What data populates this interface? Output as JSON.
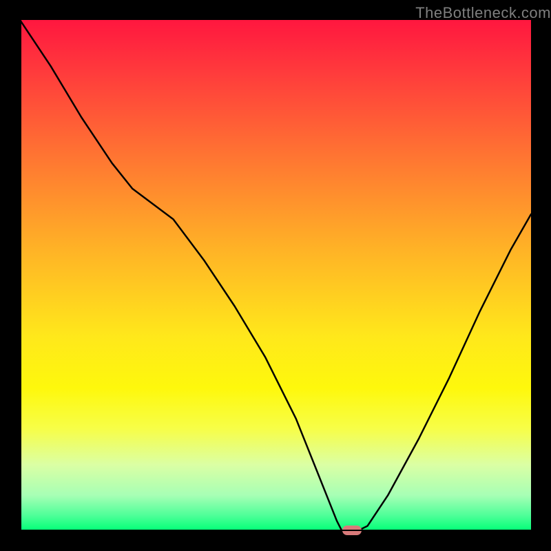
{
  "brand": "TheBottleneck.com",
  "chart_data": {
    "type": "line",
    "title": "",
    "xlabel": "",
    "ylabel": "",
    "xlim": [
      0,
      100
    ],
    "ylim": [
      0,
      100
    ],
    "grid": false,
    "legend": false,
    "series": [
      {
        "name": "bottleneck-curve",
        "x": [
          0,
          6,
          12,
          18,
          22,
          26,
          30,
          36,
          42,
          48,
          54,
          58,
          62,
          63,
          66,
          68,
          72,
          78,
          84,
          90,
          96,
          100
        ],
        "y": [
          100,
          91,
          81,
          72,
          67,
          64,
          61,
          53,
          44,
          34,
          22,
          12,
          2,
          0,
          0,
          1,
          7,
          18,
          30,
          43,
          55,
          62
        ]
      }
    ],
    "marker": {
      "x": 65,
      "y": 0
    }
  },
  "gradient_colors": {
    "top": "#ff173f",
    "mid_high": "#ffb326",
    "mid": "#ffe81b",
    "mid_low": "#f7fe48",
    "bottom": "#00ff76"
  }
}
